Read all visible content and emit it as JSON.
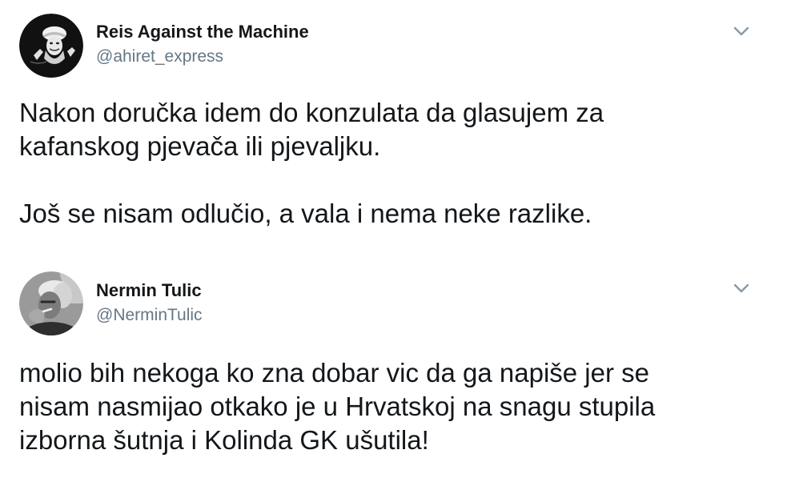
{
  "tweets": [
    {
      "author": {
        "display_name": "Reis Against the Machine",
        "handle": "@ahiret_express",
        "avatar_icon": "avatar-cleric-dark"
      },
      "menu_icon": "chevron-down-icon",
      "text_paragraphs": [
        [
          "Nakon doručka idem do konzulata da glasujem za",
          "kafanskog pjevača ili pjevaljku."
        ],
        [
          "Još se nisam odlučio, a vala i nema neke razlike."
        ]
      ]
    },
    {
      "author": {
        "display_name": "Nermin Tulic",
        "handle": "@NerminTulic",
        "avatar_icon": "avatar-photo-grey"
      },
      "menu_icon": "chevron-down-icon",
      "text_paragraphs": [
        [
          "molio bih nekoga ko zna dobar vic da ga napiše jer se",
          "nisam nasmijao otkako je u Hrvatskoj na snagu stupila",
          "izborna šutnja i Kolinda GK ušutila!"
        ]
      ]
    }
  ],
  "colors": {
    "text_primary": "#14171a",
    "text_secondary": "#657786",
    "background": "#ffffff",
    "caret": "#8899a6"
  }
}
